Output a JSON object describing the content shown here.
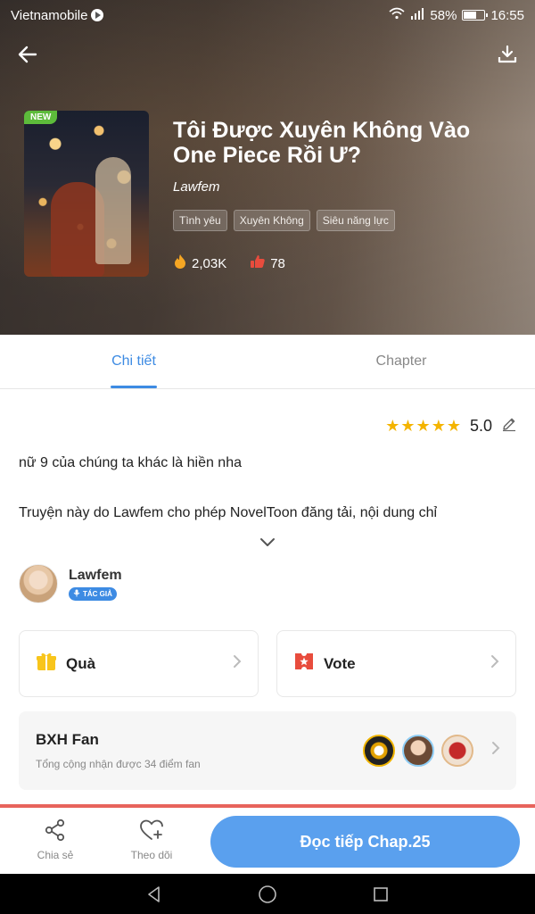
{
  "status_bar": {
    "carrier": "Vietnamobile",
    "battery": "58%",
    "time": "16:55"
  },
  "book": {
    "badge": "NEW",
    "title": "Tôi Được Xuyên Không Vào One Piece Rồi Ư?",
    "author": "Lawfem",
    "tags": [
      "Tình yêu",
      "Xuyên Không",
      "Siêu năng lực"
    ],
    "views": "2,03K",
    "likes": "78"
  },
  "tabs": [
    {
      "label": "Chi tiết",
      "active": true
    },
    {
      "label": "Chapter",
      "active": false
    }
  ],
  "rating": {
    "value": "5.0",
    "stars": 5
  },
  "description": {
    "line1": "nữ 9 của chúng ta khác là hiền nha",
    "line2": "Truyện này do Lawfem cho phép NovelToon đăng tải, nội dung chỉ"
  },
  "author_block": {
    "name": "Lawfem",
    "badge": "TÁC GIẢ"
  },
  "cards": {
    "gift_label": "Quà",
    "vote_label": "Vote"
  },
  "fan_ranking": {
    "title": "BXH Fan",
    "subtitle": "Tổng cộng nhận được 34 điểm fan"
  },
  "bottom_bar": {
    "share_label": "Chia sẻ",
    "follow_label": "Theo dõi",
    "read_button": "Đọc tiếp Chap.25"
  },
  "colors": {
    "accent": "#3d8be3",
    "read_button": "#5aa0ee",
    "star": "#f4b400",
    "badge_new": "#5dbb3b",
    "divider": "#e8645c"
  }
}
